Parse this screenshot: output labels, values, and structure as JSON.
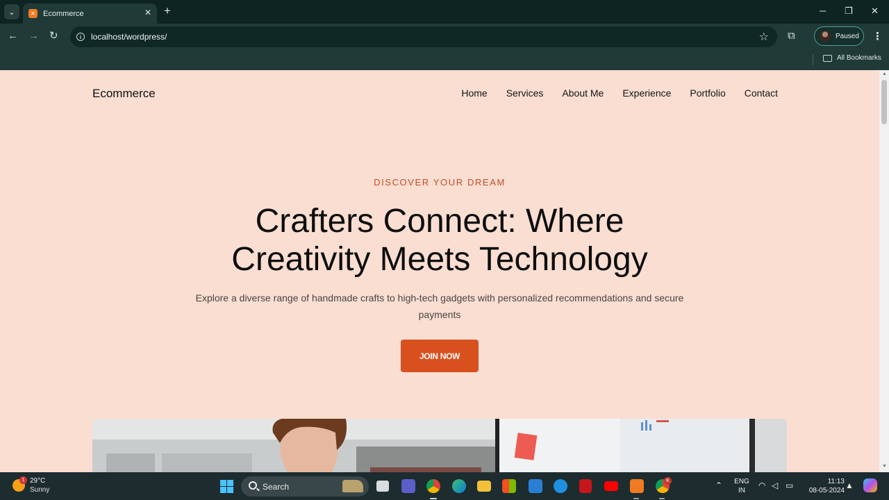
{
  "browser": {
    "tab_title": "Ecommerce",
    "tab_close_glyph": "✕",
    "new_tab_glyph": "+",
    "url": "localhost/wordpress/",
    "profile_status": "Paused",
    "bookmarks_label": "All Bookmarks",
    "icons": [
      "tab-dropdown-icon",
      "back-icon",
      "forward-icon",
      "reload-icon",
      "site-info-icon",
      "star-icon",
      "extensions-icon",
      "kebab-menu-icon",
      "folder-icon",
      "minimize-icon",
      "maximize-icon",
      "close-icon"
    ]
  },
  "site": {
    "title": "Ecommerce",
    "nav": [
      "Home",
      "Services",
      "About Me",
      "Experience",
      "Portfolio",
      "Contact"
    ]
  },
  "hero": {
    "eyebrow": "DISCOVER YOUR DREAM",
    "headline_line1": "Crafters Connect: Where",
    "headline_line2": "Creativity Meets Technology",
    "subtext": "Explore a diverse range of handmade crafts to high-tech gadgets with personalized recommendations and secure payments",
    "cta_label": "JOIN NOW"
  },
  "colors": {
    "page_bg": "#f9ded1",
    "accent": "#d9501f",
    "eyebrow": "#c64a26",
    "chrome_bg": "#1f3a37"
  },
  "taskbar": {
    "weather_temp": "29°C",
    "weather_cond": "Sunny",
    "weather_badge": "1",
    "search_label": "Search",
    "lang_line1": "ENG",
    "lang_line2": "IN",
    "time": "11:13",
    "date": "08-05-2024",
    "chrome_badge": "K"
  }
}
